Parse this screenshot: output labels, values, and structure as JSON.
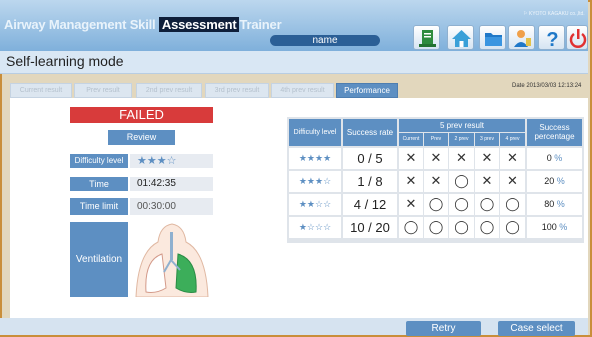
{
  "header": {
    "title_prefix": "Airway Management Skill",
    "title_highlight": "Assessment",
    "title_suffix": "Trainer",
    "user_name": "name",
    "vendor": "KYOTO KAGAKU co.,ltd."
  },
  "toolbar": {
    "icons": [
      "document-icon",
      "home-icon",
      "folder-icon",
      "person-icon",
      "help-icon",
      "power-icon"
    ]
  },
  "mode_title": "Self-learning mode",
  "tabs": [
    {
      "label": "Current result",
      "active": false
    },
    {
      "label": "Prev result",
      "active": false
    },
    {
      "label": "2nd prev result",
      "active": false
    },
    {
      "label": "3rd prev result",
      "active": false
    },
    {
      "label": "4th prev result",
      "active": false
    },
    {
      "label": "Performance",
      "active": true
    }
  ],
  "datetime": "Date 2013/03/03 12:13:24",
  "summary": {
    "status": "FAILED",
    "review_label": "Review",
    "difficulty_label": "Difficulty level",
    "difficulty_stars": "★★★☆",
    "time_label": "Time",
    "time_value": "01:42:35",
    "time_limit_label": "Time limit",
    "time_limit_value": "00:30:00",
    "ventilation_label": "Ventilation"
  },
  "performance": {
    "headers": {
      "difficulty": "Difficulty level",
      "success_rate": "Success rate",
      "prev_result": "5 prev result",
      "prev_cols": [
        "Current",
        "Prev",
        "2 prev",
        "3 prev",
        "4 prev"
      ],
      "success_percentage": "Success percentage"
    },
    "rows": [
      {
        "stars": "★★★★",
        "rate": "0 / 5",
        "marks": [
          "✕",
          "✕",
          "✕",
          "✕",
          "✕"
        ],
        "pct": "0",
        "unit": "%"
      },
      {
        "stars": "★★★☆",
        "rate": "1 / 8",
        "marks": [
          "✕",
          "✕",
          "◯",
          "✕",
          "✕"
        ],
        "pct": "20",
        "unit": "%"
      },
      {
        "stars": "★★☆☆",
        "rate": "4 / 12",
        "marks": [
          "✕",
          "◯",
          "◯",
          "◯",
          "◯"
        ],
        "pct": "80",
        "unit": "%"
      },
      {
        "stars": "★☆☆☆",
        "rate": "10 / 20",
        "marks": [
          "◯",
          "◯",
          "◯",
          "◯",
          "◯"
        ],
        "pct": "100",
        "unit": "%"
      }
    ]
  },
  "footer": {
    "retry_label": "Retry",
    "case_select_label": "Case select"
  },
  "colors": {
    "accent": "#5d8fc2",
    "failed": "#d83b3b",
    "lung_highlight": "#3cae5a"
  }
}
